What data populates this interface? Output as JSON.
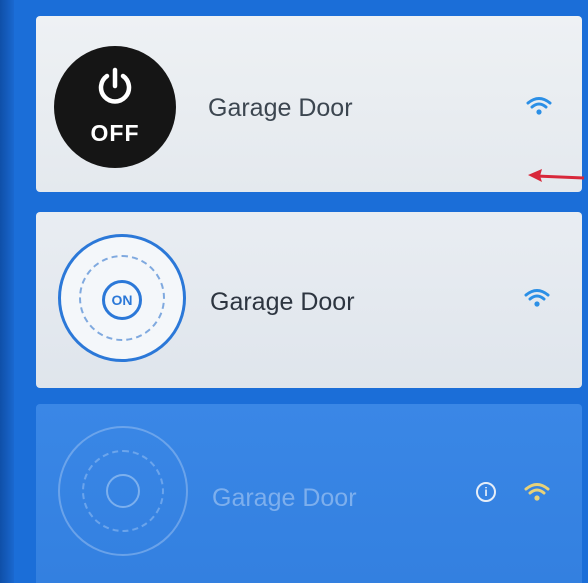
{
  "devices": [
    {
      "name": "Garage Door",
      "state_label": "OFF",
      "state": "off",
      "connectivity_icon": "wifi-icon"
    },
    {
      "name": "Garage Door",
      "state_label": "ON",
      "state": "on",
      "connectivity_icon": "wifi-icon"
    },
    {
      "name": "Garage Door",
      "state": "disabled",
      "info_icon": "info-icon",
      "connectivity_icon": "wifi-weak-icon"
    }
  ],
  "colors": {
    "background": "#1b6ed8",
    "card_light": "#eef1f4",
    "card_disabled": "#3a87e6",
    "accent_blue": "#2b78d8",
    "power_off_bg": "#151515",
    "annotation_arrow": "#d8283a"
  }
}
